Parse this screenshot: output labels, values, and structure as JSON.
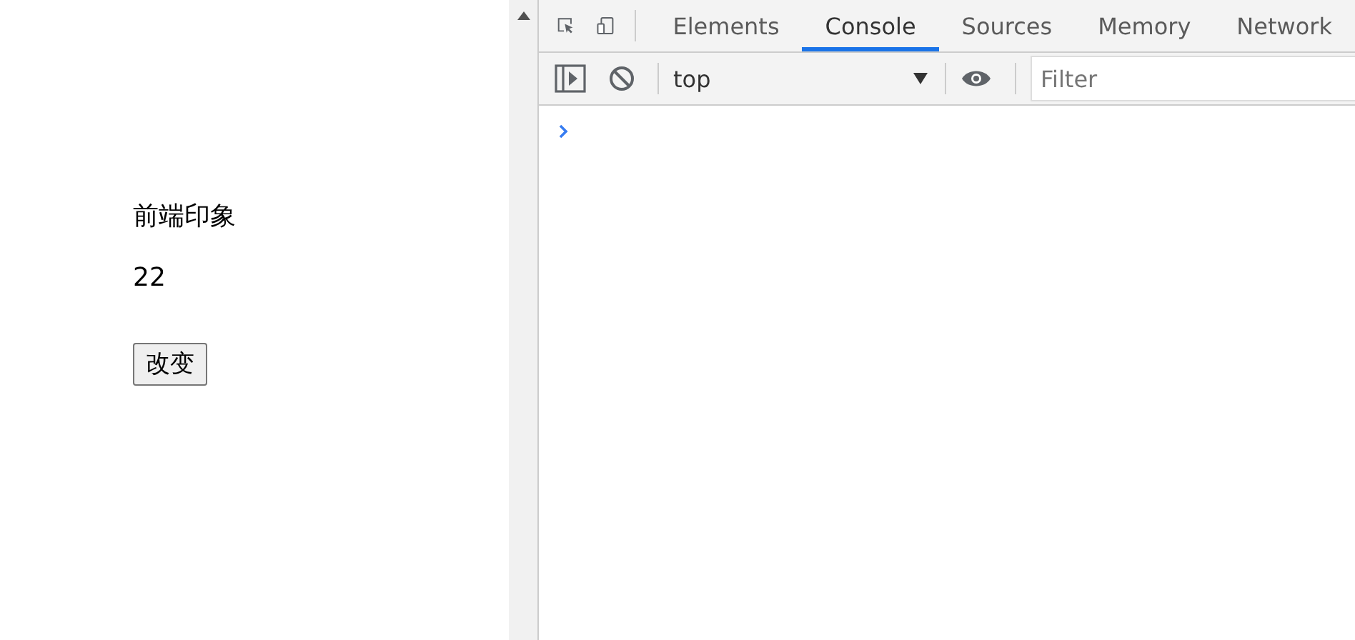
{
  "page": {
    "title": "前端印象",
    "count": "22",
    "button": "改变"
  },
  "devtools": {
    "tabs": [
      {
        "label": "Elements",
        "selected": false
      },
      {
        "label": "Console",
        "selected": true
      },
      {
        "label": "Sources",
        "selected": false
      },
      {
        "label": "Memory",
        "selected": false
      },
      {
        "label": "Network",
        "selected": false
      }
    ],
    "context": "top",
    "filter": {
      "placeholder": "Filter"
    }
  }
}
